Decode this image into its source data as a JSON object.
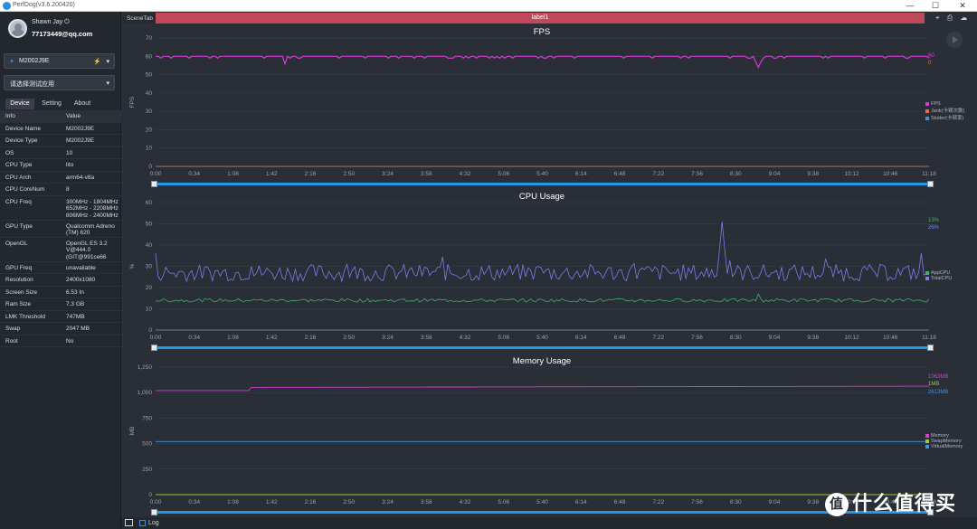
{
  "app": {
    "title": "PerfDog(v3.6.200420)",
    "min": "—",
    "max": "☐",
    "close": "✕"
  },
  "user": {
    "name": "Shawn Jay ⏻",
    "email": "77173449@qq.com"
  },
  "device_select": {
    "value": "M2002J9E"
  },
  "app_select": {
    "value": "请选择测试应用"
  },
  "tabs": [
    "Device",
    "Setting",
    "About"
  ],
  "info": {
    "header": {
      "k": "Info",
      "v": "Value"
    },
    "rows": [
      {
        "k": "Device Name",
        "v": "M2002J9E"
      },
      {
        "k": "Device Type",
        "v": "M2002J9E"
      },
      {
        "k": "OS",
        "v": "10"
      },
      {
        "k": "CPU Type",
        "v": "lito"
      },
      {
        "k": "CPU Arch",
        "v": "arm64-v8a"
      },
      {
        "k": "CPU CoreNum",
        "v": "8"
      },
      {
        "k": "CPU Freq",
        "v": "300MHz - 1804MHz\n652MHz - 2208MHz\n806MHz - 2400MHz"
      },
      {
        "k": "GPU Type",
        "v": "Qualcomm Adreno\n(TM) 620"
      },
      {
        "k": "OpenGL",
        "v": "OpenGL ES 3.2\nV@444.0\n(GIT@991ce66"
      },
      {
        "k": "GPU Freq",
        "v": "unavailable"
      },
      {
        "k": "Resolution",
        "v": "2400x1080"
      },
      {
        "k": "Screen Size",
        "v": "6.53 In"
      },
      {
        "k": "Ram Size",
        "v": "7.3 GB"
      },
      {
        "k": "LMK Threshold",
        "v": "747MB"
      },
      {
        "k": "Swap",
        "v": "2047 MB"
      },
      {
        "k": "Root",
        "v": "No"
      }
    ]
  },
  "scene": {
    "tab": "SceneTab",
    "label": "label1"
  },
  "log": {
    "label": "Log"
  },
  "watermark": {
    "badge": "值",
    "text": "什么值得买"
  },
  "colors": {
    "fps": "#d63bd6",
    "jank": "#e8703a",
    "stutter": "#4a90d9",
    "app_cpu": "#3fb26b",
    "total_cpu": "#7a7ee6",
    "memory": "#d63bd6",
    "swap": "#9acd32",
    "virtual": "#4a90d9",
    "scroll": "#1f9ae8"
  },
  "x_ticks": [
    "0:00",
    "0:34",
    "1:08",
    "1:42",
    "2:16",
    "2:50",
    "3:24",
    "3:58",
    "4:32",
    "5:06",
    "5:40",
    "6:14",
    "6:48",
    "7:22",
    "7:56",
    "8:30",
    "9:04",
    "9:38",
    "10:12",
    "10:46",
    "11:18"
  ],
  "chart_data": [
    {
      "type": "line",
      "title": "FPS",
      "ylabel": "FPS",
      "ylim": [
        0,
        70
      ],
      "yticks": [
        "0",
        "10",
        "20",
        "30",
        "40",
        "50",
        "60",
        "70"
      ],
      "duration_s": 678,
      "series": [
        {
          "name": "FPS",
          "values_summary": "≈60 throughout with dips to ~56 near 1:36 and ~54 near 9:00",
          "current": "60"
        },
        {
          "name": "Jank(卡顿次数)",
          "values_summary": "0",
          "current": "0"
        },
        {
          "name": "Stutter(卡顿率)",
          "values_summary": "",
          "current": ""
        }
      ],
      "legend": [
        "FPS",
        "Jank(卡顿次数)",
        "Stutter(卡顿率)"
      ],
      "current_labels": [
        "60",
        "0"
      ]
    },
    {
      "type": "line",
      "title": "CPU Usage",
      "ylabel": "%",
      "ylim": [
        0,
        60
      ],
      "yticks": [
        "0",
        "10",
        "20",
        "30",
        "40",
        "50",
        "60"
      ],
      "series": [
        {
          "name": "AppCPU",
          "approx_level": 14,
          "current": "13%"
        },
        {
          "name": "TotalCPU",
          "approx_level": 27,
          "peak": 51,
          "current": "26%"
        }
      ],
      "legend": [
        "AppCPU",
        "TotalCPU"
      ],
      "current_labels": [
        "13%",
        "26%"
      ]
    },
    {
      "type": "line",
      "title": "Memory Usage",
      "ylabel": "MB",
      "ylim": [
        0,
        1250
      ],
      "yticks": [
        "0",
        "250",
        "500",
        "750",
        "1,000",
        "1,250"
      ],
      "series": [
        {
          "name": "Memory",
          "start": 1020,
          "end": 1063,
          "current": "1063MB"
        },
        {
          "name": "SwapMemory",
          "level": 1,
          "current": "1MB"
        },
        {
          "name": "VirtualMemory",
          "level_plotted": 520,
          "current": "2613MB"
        }
      ],
      "legend": [
        "Memory",
        "SwapMemory",
        "VirtualMemory"
      ],
      "current_labels": [
        "1063MB",
        "1MB",
        "2613MB"
      ]
    }
  ]
}
